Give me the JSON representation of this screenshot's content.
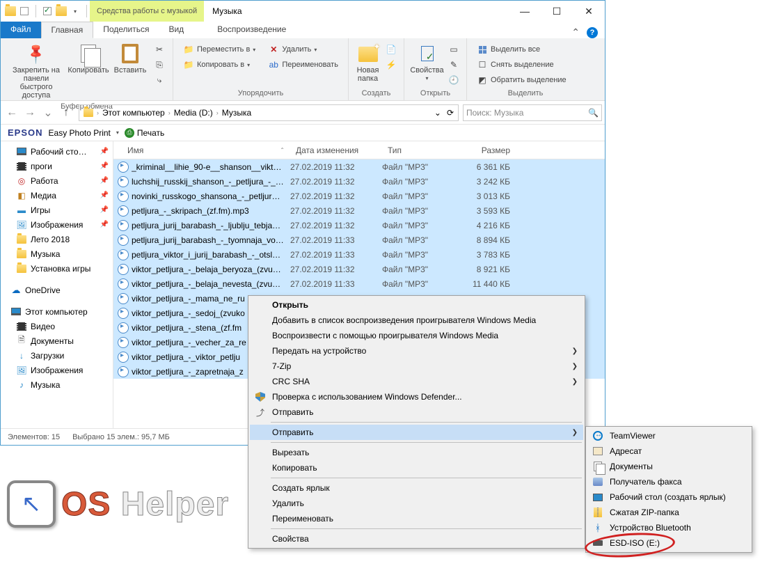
{
  "title": "Музыка",
  "contextual_tab": "Средства работы с музыкой",
  "tabs": {
    "file": "Файл",
    "home": "Главная",
    "share": "Поделиться",
    "view": "Вид",
    "music": "Воспроизведение"
  },
  "ribbon": {
    "clipboard": {
      "title": "Буфер обмена",
      "pin": "Закрепить на панели\nбыстрого доступа",
      "copy": "Копировать",
      "paste": "Вставить"
    },
    "organize": {
      "title": "Упорядочить",
      "move": "Переместить в",
      "copyto": "Копировать в",
      "delete": "Удалить",
      "rename": "Переименовать"
    },
    "new": {
      "title": "Создать",
      "newfolder": "Новая\nпапка"
    },
    "open": {
      "title": "Открыть",
      "props": "Свойства"
    },
    "select": {
      "title": "Выделить",
      "all": "Выделить все",
      "none": "Снять выделение",
      "invert": "Обратить выделение"
    }
  },
  "breadcrumb": [
    "Этот компьютер",
    "Media (D:)",
    "Музыка"
  ],
  "search_placeholder": "Поиск: Музыка",
  "epson": {
    "logo": "EPSON",
    "epp": "Easy Photo Print",
    "print": "Печать"
  },
  "tree": {
    "desktop": "Рабочий сто…",
    "progi": "проги",
    "rabota": "Работа",
    "media": "Медиа",
    "igry": "Игры",
    "images": "Изображения",
    "leto": "Лето 2018",
    "music": "Музыка",
    "install": "Установка игры",
    "onedrive": "OneDrive",
    "thispc": "Этот компьютер",
    "video": "Видео",
    "docs": "Документы",
    "downloads": "Загрузки",
    "images2": "Изображения",
    "music2": "Музыка"
  },
  "columns": {
    "name": "Имя",
    "date": "Дата изменения",
    "type": "Тип",
    "size": "Размер"
  },
  "files": [
    {
      "name": "_kriminal__lihie_90-e__shanson__viktor_p...",
      "date": "27.02.2019 11:32",
      "type": "Файл \"MP3\"",
      "size": "6 361 КБ",
      "sel": true
    },
    {
      "name": "luchshij_russkij_shanson_-_petljura_-_pla...",
      "date": "27.02.2019 11:32",
      "type": "Файл \"MP3\"",
      "size": "3 242 КБ",
      "sel": true
    },
    {
      "name": "novinki_russkogo_shansona_-_petljura_ju...",
      "date": "27.02.2019 11:32",
      "type": "Файл \"MP3\"",
      "size": "3 013 КБ",
      "sel": true
    },
    {
      "name": "petljura_-_skripach_(zf.fm).mp3",
      "date": "27.02.2019 11:32",
      "type": "Файл \"MP3\"",
      "size": "3 593 КБ",
      "sel": true
    },
    {
      "name": "petljura_jurij_barabash_-_ljublju_tebja_(zv...",
      "date": "27.02.2019 11:32",
      "type": "Файл \"MP3\"",
      "size": "4 216 КБ",
      "sel": true
    },
    {
      "name": "petljura_jurij_barabash_-_tyomnaja_voda...",
      "date": "27.02.2019 11:33",
      "type": "Файл \"MP3\"",
      "size": "8 894 КБ",
      "sel": true
    },
    {
      "name": "petljura_viktor_i_jurij_barabash_-_otsluzhi...",
      "date": "27.02.2019 11:33",
      "type": "Файл \"MP3\"",
      "size": "3 783 КБ",
      "sel": true
    },
    {
      "name": "viktor_petljura_-_belaja_beryoza_(zvukoff....",
      "date": "27.02.2019 11:32",
      "type": "Файл \"MP3\"",
      "size": "8 921 КБ",
      "sel": true
    },
    {
      "name": "viktor_petljura_-_belaja_nevesta_(zvukoff....",
      "date": "27.02.2019 11:33",
      "type": "Файл \"MP3\"",
      "size": "11 440 КБ",
      "sel": true
    },
    {
      "name": "viktor_petljura_-_mama_ne_ru",
      "date": "",
      "type": "",
      "size": "",
      "sel": true
    },
    {
      "name": "viktor_petljura_-_sedoj_(zvuko",
      "date": "",
      "type": "",
      "size": "",
      "sel": true
    },
    {
      "name": "viktor_petljura_-_stena_(zf.fm",
      "date": "",
      "type": "",
      "size": "",
      "sel": true
    },
    {
      "name": "viktor_petljura_-_vecher_za_re",
      "date": "",
      "type": "",
      "size": "",
      "sel": true
    },
    {
      "name": "viktor_petljura_-_viktor_petlju",
      "date": "",
      "type": "",
      "size": "",
      "sel": true
    },
    {
      "name": "viktor_petljura_-_zapretnaja_z",
      "date": "",
      "type": "",
      "size": "",
      "sel": true
    }
  ],
  "status": {
    "count": "Элементов: 15",
    "sel": "Выбрано 15 элем.: 95,7 МБ"
  },
  "ctx": {
    "open": "Открыть",
    "add_wmp": "Добавить в список воспроизведения проигрывателя Windows Media",
    "play_wmp": "Воспроизвести с помощью проигрывателя Windows Media",
    "cast": "Передать на устройство",
    "7zip": "7-Zip",
    "crcsha": "CRC SHA",
    "defender": "Проверка с использованием Windows Defender...",
    "share": "Отправить",
    "sendto": "Отправить",
    "cut": "Вырезать",
    "copy": "Копировать",
    "shortcut": "Создать ярлык",
    "delete": "Удалить",
    "rename": "Переименовать",
    "props": "Свойства"
  },
  "sendto_items": {
    "teamviewer": "TeamViewer",
    "adresat": "Адресат",
    "docs": "Документы",
    "fax": "Получатель факса",
    "desktop": "Рабочий стол (создать ярлык)",
    "zip": "Сжатая ZIP-папка",
    "bluetooth": "Устройство Bluetooth",
    "esd": "ESD-ISO (E:)"
  },
  "watermark": {
    "os": "OS",
    "helper": " Helper"
  }
}
